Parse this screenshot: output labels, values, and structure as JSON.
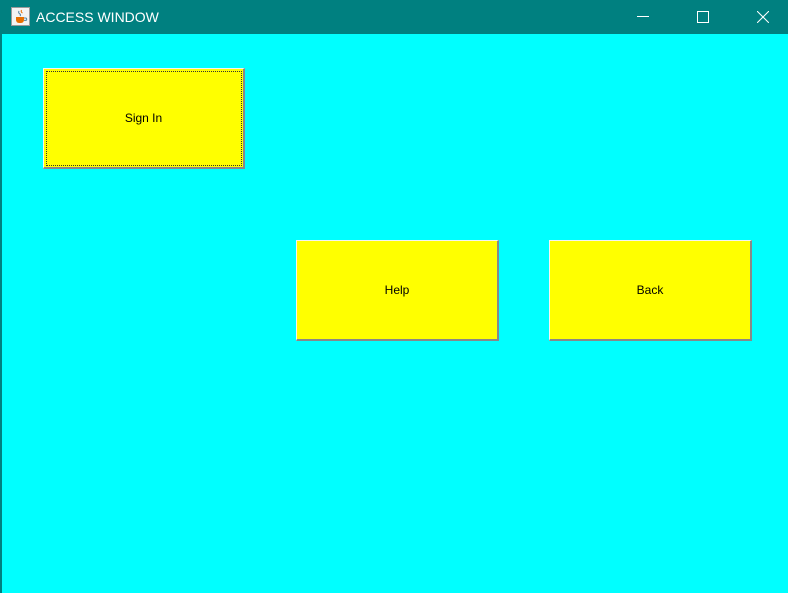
{
  "window": {
    "title": "ACCESS WINDOW",
    "icon": "java-cup-icon",
    "controls": [
      "minimize-icon",
      "maximize-icon",
      "close-icon"
    ],
    "colors": {
      "titlebar": "#008080",
      "background": "#00ffff",
      "button": "#ffff00"
    }
  },
  "buttons": {
    "sign_in": "Sign In",
    "help": "Help",
    "back": "Back"
  }
}
